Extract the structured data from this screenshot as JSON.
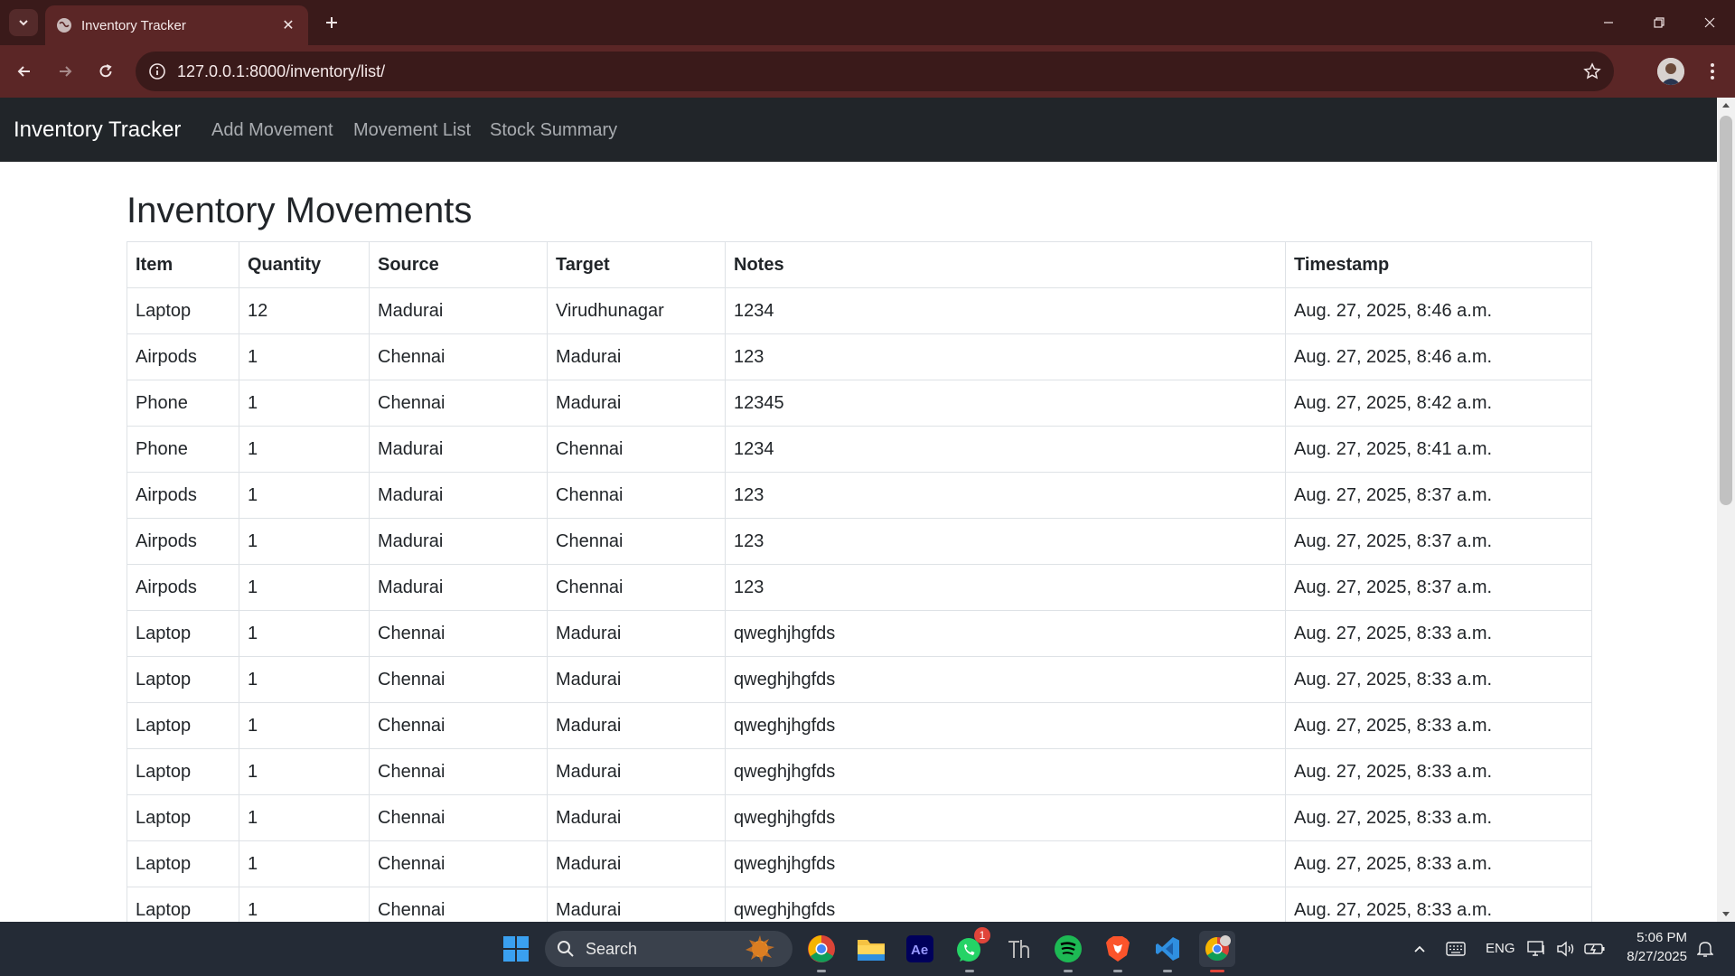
{
  "browser": {
    "tab_title": "Inventory Tracker",
    "url": "127.0.0.1:8000/inventory/list/"
  },
  "navbar": {
    "brand": "Inventory Tracker",
    "links": [
      "Add Movement",
      "Movement List",
      "Stock Summary"
    ]
  },
  "main": {
    "title": "Inventory Movements",
    "columns": [
      "Item",
      "Quantity",
      "Source",
      "Target",
      "Notes",
      "Timestamp"
    ],
    "rows": [
      [
        "Laptop",
        "12",
        "Madurai",
        "Virudhunagar",
        "1234",
        "Aug. 27, 2025, 8:46 a.m."
      ],
      [
        "Airpods",
        "1",
        "Chennai",
        "Madurai",
        "123",
        "Aug. 27, 2025, 8:46 a.m."
      ],
      [
        "Phone",
        "1",
        "Chennai",
        "Madurai",
        "12345",
        "Aug. 27, 2025, 8:42 a.m."
      ],
      [
        "Phone",
        "1",
        "Madurai",
        "Chennai",
        "1234",
        "Aug. 27, 2025, 8:41 a.m."
      ],
      [
        "Airpods",
        "1",
        "Madurai",
        "Chennai",
        "123",
        "Aug. 27, 2025, 8:37 a.m."
      ],
      [
        "Airpods",
        "1",
        "Madurai",
        "Chennai",
        "123",
        "Aug. 27, 2025, 8:37 a.m."
      ],
      [
        "Airpods",
        "1",
        "Madurai",
        "Chennai",
        "123",
        "Aug. 27, 2025, 8:37 a.m."
      ],
      [
        "Laptop",
        "1",
        "Chennai",
        "Madurai",
        "qweghjhgfds",
        "Aug. 27, 2025, 8:33 a.m."
      ],
      [
        "Laptop",
        "1",
        "Chennai",
        "Madurai",
        "qweghjhgfds",
        "Aug. 27, 2025, 8:33 a.m."
      ],
      [
        "Laptop",
        "1",
        "Chennai",
        "Madurai",
        "qweghjhgfds",
        "Aug. 27, 2025, 8:33 a.m."
      ],
      [
        "Laptop",
        "1",
        "Chennai",
        "Madurai",
        "qweghjhgfds",
        "Aug. 27, 2025, 8:33 a.m."
      ],
      [
        "Laptop",
        "1",
        "Chennai",
        "Madurai",
        "qweghjhgfds",
        "Aug. 27, 2025, 8:33 a.m."
      ],
      [
        "Laptop",
        "1",
        "Chennai",
        "Madurai",
        "qweghjhgfds",
        "Aug. 27, 2025, 8:33 a.m."
      ],
      [
        "Laptop",
        "1",
        "Chennai",
        "Madurai",
        "qweghjhgfds",
        "Aug. 27, 2025, 8:33 a.m."
      ]
    ]
  },
  "taskbar": {
    "search_label": "Search",
    "language": "ENG",
    "time": "5:06 PM",
    "date": "8/27/2025",
    "whatsapp_badge": "1",
    "icons": [
      "windows-start-icon",
      "chrome-icon",
      "file-explorer-icon",
      "after-effects-icon",
      "whatsapp-icon",
      "typora-icon",
      "spotify-icon",
      "brave-icon",
      "vscode-icon",
      "chrome-profile-icon"
    ]
  },
  "colors": {
    "frame_dark": "#3a1a1a",
    "frame_tab": "#5b2626",
    "navbar_bg": "#212529",
    "nav_link": "#a9acb0",
    "table_border": "#dee2e6",
    "taskbar_bg": "#242b36"
  }
}
